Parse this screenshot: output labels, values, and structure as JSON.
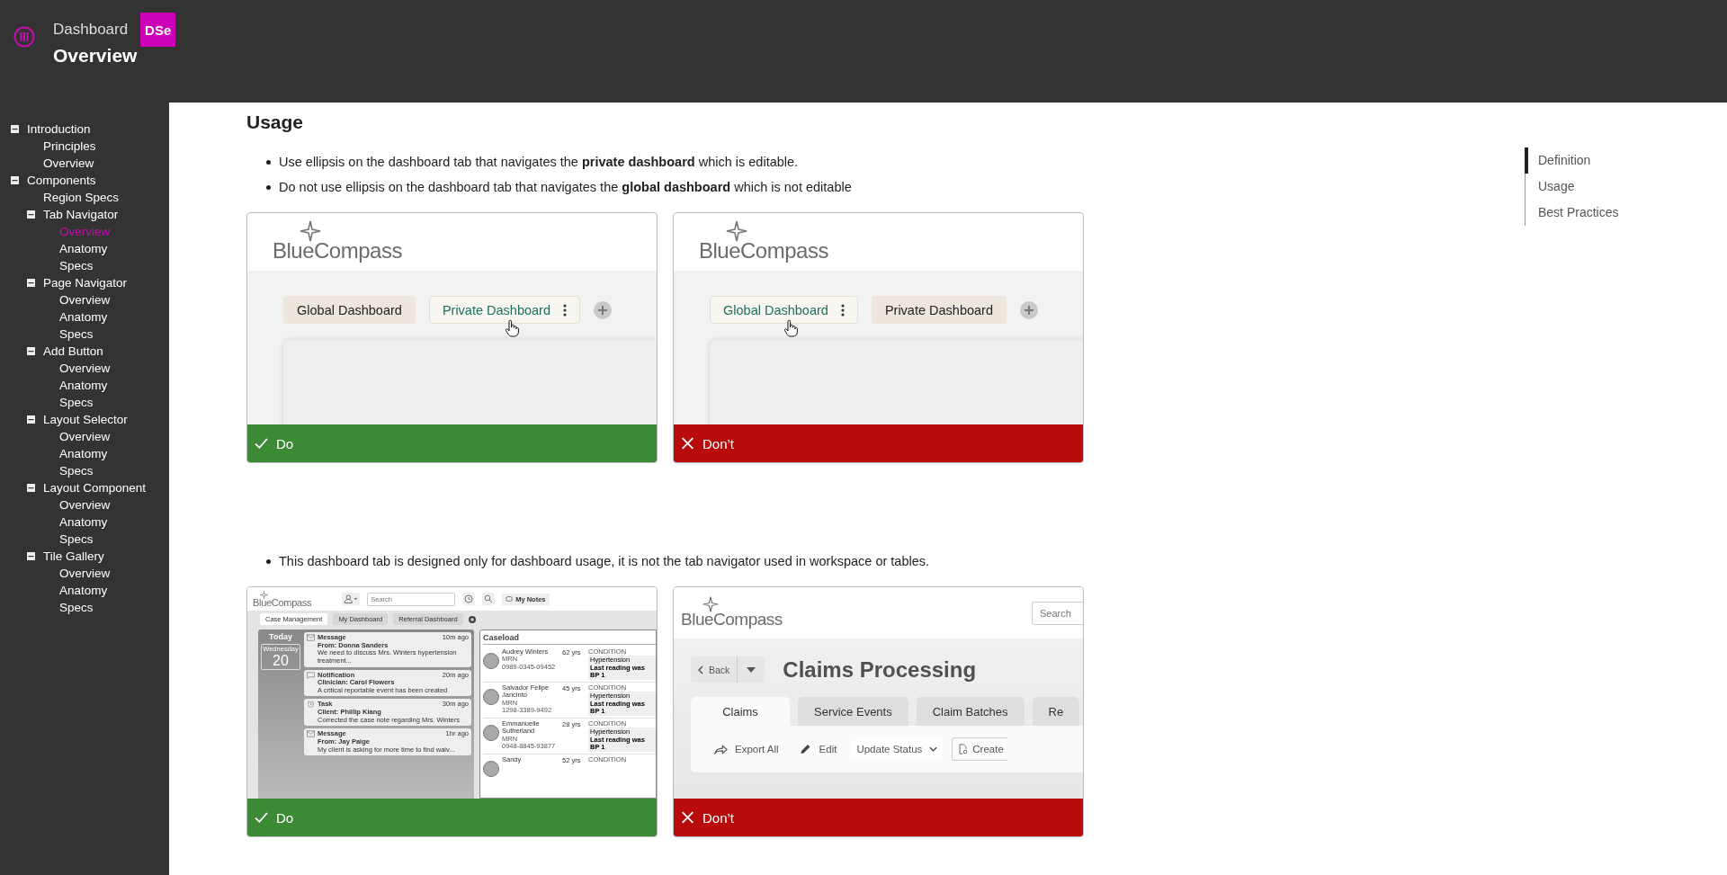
{
  "header": {
    "section": "Dashboard",
    "badge": "DSe",
    "title": "Overview"
  },
  "sidebar": {
    "items": [
      {
        "label": "Introduction",
        "selected": false,
        "expanded": true,
        "children": [
          {
            "label": "Principles",
            "selected": false
          },
          {
            "label": "Overview",
            "selected": false
          }
        ]
      },
      {
        "label": "Components",
        "selected": false,
        "expanded": true,
        "children": [
          {
            "label": "Region Specs",
            "selected": false
          },
          {
            "label": "Tab Navigator",
            "selected": false,
            "expanded": true,
            "children": [
              {
                "label": "Overview",
                "selected": true
              },
              {
                "label": "Anatomy",
                "selected": false
              },
              {
                "label": "Specs",
                "selected": false
              }
            ]
          },
          {
            "label": "Page Navigator",
            "selected": false,
            "expanded": true,
            "children": [
              {
                "label": "Overview",
                "selected": false
              },
              {
                "label": "Anatomy",
                "selected": false
              },
              {
                "label": "Specs",
                "selected": false
              }
            ]
          },
          {
            "label": "Add Button",
            "selected": false,
            "expanded": true,
            "children": [
              {
                "label": "Overview",
                "selected": false
              },
              {
                "label": "Anatomy",
                "selected": false
              },
              {
                "label": "Specs",
                "selected": false
              }
            ]
          },
          {
            "label": "Layout Selector",
            "selected": false,
            "expanded": true,
            "children": [
              {
                "label": "Overview",
                "selected": false
              },
              {
                "label": "Anatomy",
                "selected": false
              },
              {
                "label": "Specs",
                "selected": false
              }
            ]
          },
          {
            "label": "Layout Component",
            "selected": false,
            "expanded": true,
            "children": [
              {
                "label": "Overview",
                "selected": false
              },
              {
                "label": "Anatomy",
                "selected": false
              },
              {
                "label": "Specs",
                "selected": false
              }
            ]
          },
          {
            "label": "Tile Gallery",
            "selected": false,
            "expanded": true,
            "children": [
              {
                "label": "Overview",
                "selected": false
              },
              {
                "label": "Anatomy",
                "selected": false
              },
              {
                "label": "Specs",
                "selected": false
              }
            ]
          }
        ]
      }
    ]
  },
  "content": {
    "heading": "Usage",
    "blocks": [
      {
        "bullets": [
          "Use ellipsis on the dashboard tab that navigates the **private dashboard** which is editable.",
          "Do not use ellipsis on the dashboard tab that navigates the **global dashboard** which is not editable"
        ],
        "examples": [
          {
            "kind": "approve",
            "color": "#3c8a34",
            "label": "Do",
            "screen": {
              "kind": "tabs",
              "logo": "BlueCompass",
              "tabs": [
                {
                  "label": "Global Dashboard",
                  "hovered": false,
                  "menu": false
                },
                {
                  "label": "Private Dashboard",
                  "hovered": true,
                  "menu": true
                }
              ]
            }
          },
          {
            "kind": "reject",
            "color": "#b80c0c",
            "label": "Don’t",
            "screen": {
              "kind": "tabs",
              "logo": "BlueCompass",
              "tabs": [
                {
                  "label": "Global Dashboard",
                  "hovered": true,
                  "menu": true
                },
                {
                  "label": "Private Dashboard",
                  "hovered": false,
                  "menu": false
                }
              ]
            }
          }
        ]
      },
      {
        "bullets": [
          "This dashboard tab is designed only for dashboard usage, it is not the tab navigator used in workspace or tables."
        ],
        "examples": [
          {
            "kind": "approve",
            "color": "#3c8a34",
            "label": "Do",
            "screen": {
              "kind": "dashboard",
              "logo": "BlueCompass",
              "search": {
                "placeholder": "Search"
              },
              "notes_button": "My Notes",
              "tabs": [
                {
                  "label": "Case Management",
                  "selected": true
                },
                {
                  "label": "My Dashboard",
                  "selected": false
                },
                {
                  "label": "Referral Dashboard",
                  "selected": false
                }
              ],
              "today": {
                "title": "Today",
                "weekday": "Wednesday",
                "day": "20"
              },
              "feed": [
                {
                  "kind": "message",
                  "title": "Message",
                  "time": "10m ago",
                  "from": "From: Donna Sanders",
                  "text": "We need to discuss Mrs. Winters hypertension treatment..."
                },
                {
                  "kind": "notification",
                  "title": "Notification",
                  "time": "20m ago",
                  "from": "Clinician: Carol Flowers",
                  "text": "A critical reportable event has been created"
                },
                {
                  "kind": "task",
                  "title": "Task",
                  "time": "30m ago",
                  "from": "Client: Phillip Kiang",
                  "text": "Corrected the case note regarding Mrs. Winters"
                },
                {
                  "kind": "message",
                  "title": "Message",
                  "time": "1hr ago",
                  "from": "From: Jay Paige",
                  "text": "My client is asking for more time to find waiv..."
                }
              ],
              "caseload": {
                "title": "Caseload",
                "patients": [
                  {
                    "name": "Audrey Winters",
                    "age": "62 yrs",
                    "mrn_label": "MRN",
                    "mrn": "0989-0345-09452",
                    "condition_label": "CONDITION",
                    "condition": "Hypertension",
                    "note": "Last reading was BP 1"
                  },
                  {
                    "name": "Salvador Felipe Jancinto",
                    "age": "45 yrs",
                    "mrn_label": "MRN",
                    "mrn": "1298-3389-9492",
                    "condition_label": "CONDITION",
                    "condition": "Hypertension",
                    "note": "Last reading was BP 1"
                  },
                  {
                    "name": "Emmanuelle Sutherland",
                    "age": "28 yrs",
                    "mrn_label": "MRN",
                    "mrn": "0948-8845-93877",
                    "condition_label": "CONDITION",
                    "condition": "Hypertension",
                    "note": "Last reading was BP 1"
                  },
                  {
                    "name": "Sandy",
                    "age": "52 yrs",
                    "condition_label": "CONDITION"
                  }
                ]
              }
            }
          },
          {
            "kind": "reject",
            "color": "#b80c0c",
            "label": "Don’t",
            "screen": {
              "kind": "claims",
              "logo": "BlueCompass",
              "search": {
                "placeholder": "Search"
              },
              "back_button": "Back",
              "title": "Claims Processing",
              "tabs": [
                {
                  "label": "Claims",
                  "selected": true
                },
                {
                  "label": "Service Events",
                  "selected": false
                },
                {
                  "label": "Claim Batches",
                  "selected": false
                },
                {
                  "label": "Re",
                  "selected": false
                }
              ],
              "actions": [
                {
                  "kind": "export",
                  "label": "Export All"
                },
                {
                  "kind": "edit",
                  "label": "Edit"
                },
                {
                  "kind": "dropdown",
                  "label": "Update Status"
                },
                {
                  "kind": "create",
                  "label": "Create"
                }
              ]
            }
          }
        ]
      }
    ]
  },
  "page_nav": {
    "items": [
      {
        "label": "Definition",
        "selected": true
      },
      {
        "label": "Usage",
        "selected": false
      },
      {
        "label": "Best Practices",
        "selected": false
      }
    ]
  }
}
